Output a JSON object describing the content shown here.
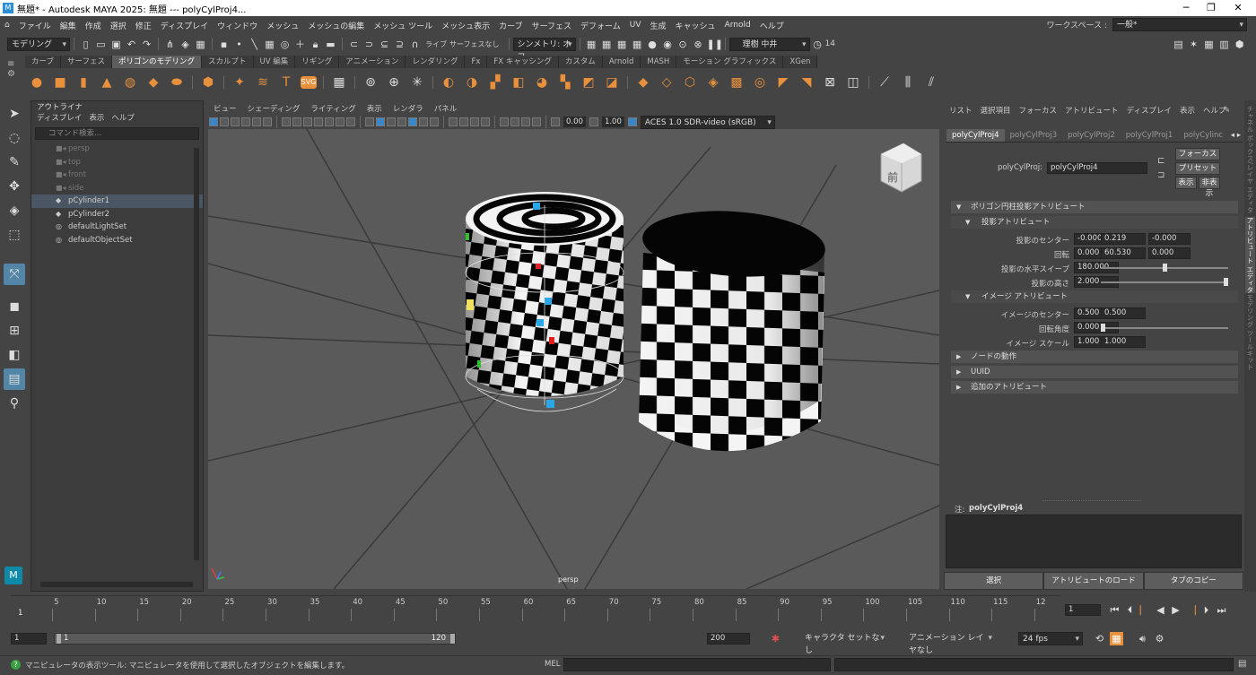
{
  "window": {
    "title": "無題* - Autodesk MAYA 2025: 無題   ---   polyCylProj4..."
  },
  "menubar": {
    "items": [
      "ファイル",
      "編集",
      "作成",
      "選択",
      "修正",
      "ディスプレイ",
      "ウィンドウ",
      "メッシュ",
      "メッシュの編集",
      "メッシュ ツール",
      "メッシュ表示",
      "カーブ",
      "サーフェス",
      "デフォーム",
      "UV",
      "生成",
      "キャッシュ",
      "Arnold",
      "ヘルプ"
    ],
    "workspace_label": "ワークスペース :",
    "workspace_value": "一般*"
  },
  "statusline": {
    "mode": "モデリング",
    "live_label": "ライブ",
    "live_value": "サーフェスなし",
    "symmetry": "シンメトリ: オフ",
    "user": "理樹 中井",
    "notifications": "14"
  },
  "shelf": {
    "tabs": [
      "カーブ",
      "サーフェス",
      "ポリゴンのモデリング",
      "スカルプト",
      "UV 編集",
      "リギング",
      "アニメーション",
      "レンダリング",
      "Fx",
      "FX キャッシング",
      "カスタム",
      "Arnold",
      "MASH",
      "モーション グラフィックス",
      "XGen"
    ],
    "active_tab": 2
  },
  "outliner": {
    "title": "アウトライナ",
    "menus": [
      "ディスプレイ",
      "表示",
      "ヘルプ"
    ],
    "search_placeholder": "コマンド検索...",
    "items": [
      {
        "label": "persp",
        "dim": true,
        "icon": "camera-icon"
      },
      {
        "label": "top",
        "dim": true,
        "icon": "camera-icon"
      },
      {
        "label": "front",
        "dim": true,
        "icon": "camera-icon"
      },
      {
        "label": "side",
        "dim": true,
        "icon": "camera-icon"
      },
      {
        "label": "pCylinder1",
        "dim": false,
        "selected": true,
        "icon": "mesh-icon"
      },
      {
        "label": "pCylinder2",
        "dim": false,
        "icon": "mesh-icon"
      },
      {
        "label": "defaultLightSet",
        "dim": false,
        "icon": "set-icon"
      },
      {
        "label": "defaultObjectSet",
        "dim": false,
        "icon": "set-icon"
      }
    ]
  },
  "viewport": {
    "menus": [
      "ビュー",
      "シェーディング",
      "ライティング",
      "表示",
      "レンダラ",
      "パネル"
    ],
    "exposure": "0.00",
    "gamma": "1.00",
    "colorspace": "ACES 1.0 SDR-video (sRGB)",
    "camera_label": "persp",
    "viewcube_label": "前"
  },
  "attribute_editor": {
    "menus": [
      "リスト",
      "選択項目",
      "フォーカス",
      "アトリビュート",
      "ディスプレイ",
      "表示",
      "ヘルプ"
    ],
    "tabs": [
      "polyCylProj4",
      "polyCylProj3",
      "polyCylProj2",
      "polyCylProj1",
      "polyCylinc"
    ],
    "node_label": "polyCylProj:",
    "node_value": "polyCylProj4",
    "focus_button": "フォーカス",
    "preset_button": "プリセット",
    "show_button": "表示",
    "hide_button": "非表示",
    "section_main": "ポリゴン円柱投影アトリビュート",
    "section_proj": "投影アトリビュート",
    "proj_center_label": "投影のセンター",
    "proj_center": [
      "-0.000",
      "0.219",
      "-0.000"
    ],
    "rotate_label": "回転",
    "rotate": [
      "0.000",
      "60.530",
      "0.000"
    ],
    "sweep_label": "投影の水平スイープ",
    "sweep": "180.000",
    "height_label": "投影の高さ",
    "height": "2.000",
    "section_image": "イメージ アトリビュート",
    "image_center_label": "イメージのセンター",
    "image_center": [
      "0.500",
      "0.500"
    ],
    "rot_angle_label": "回転角度",
    "rot_angle": "0.000",
    "image_scale_label": "イメージ スケール",
    "image_scale": [
      "1.000",
      "1.000"
    ],
    "section_node": "ノードの動作",
    "section_uuid": "UUID",
    "section_extra": "追加のアトリビュート",
    "notes_label": "注:",
    "notes_value": "polyCylProj4",
    "bottom_buttons": [
      "選択",
      "アトリビュートのロード",
      "タブのコピー"
    ],
    "side_tabs": [
      "チャネル ボックス/レイヤ エディタ",
      "アトリビュート エディタ",
      "モデリング ツールキット"
    ]
  },
  "timeline": {
    "ticks": [
      "5",
      "10",
      "15",
      "20",
      "25",
      "30",
      "35",
      "40",
      "45",
      "50",
      "55",
      "60",
      "65",
      "70",
      "75",
      "80",
      "85",
      "90",
      "95",
      "100",
      "105",
      "110",
      "115",
      "12"
    ],
    "current_frame_marker": "1",
    "current_frame": "1"
  },
  "range": {
    "start": "1",
    "inner_start": "1",
    "inner_end": "120",
    "end": "200",
    "character_set": "キャラクタ セットなし",
    "anim_layer": "アニメーション レイヤなし",
    "fps": "24 fps"
  },
  "commandline": {
    "help_text": "マニピュレータの表示ツール: マニピュレータを使用して選択したオブジェクトを編集します。",
    "lang": "MEL"
  }
}
